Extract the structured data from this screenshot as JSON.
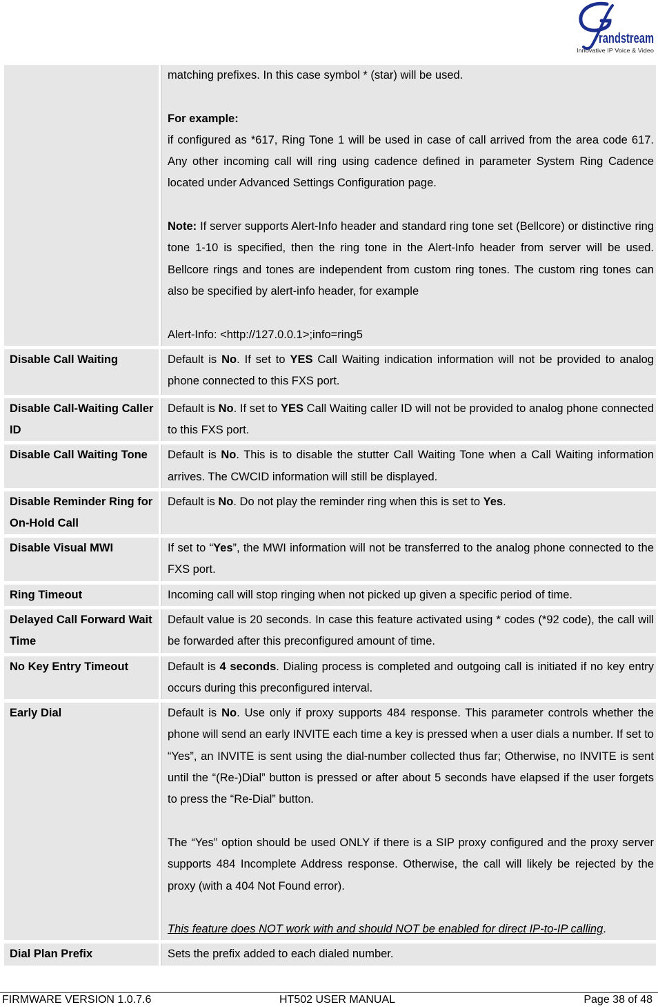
{
  "header": {
    "logo_text": "randstream",
    "logo_initial": "G",
    "logo_tagline": "Innovative IP Voice & Video",
    "logo_color": "#1b2f8f"
  },
  "table": {
    "rows": [
      {
        "name": "",
        "desc": {
          "line1": "matching prefixes. In this case symbol * (star) will be used.",
          "example_label": "For example:",
          "example_text": " if configured as *617, Ring Tone 1 will be used in case of call arrived from the area code 617. Any other incoming call will ring using cadence defined in parameter System Ring Cadence located under Advanced Settings Configuration page.",
          "note_label": "Note:",
          "note_text": " If server supports Alert-Info header and standard ring tone set (Bellcore) or distinctive ring tone 1-10 is specified, then the ring tone in the Alert-Info header from server will be used. Bellcore rings and tones are independent from custom ring tones. The custom ring tones can also be specified by alert-info header, for example",
          "alert_example": "Alert-Info: <http://127.0.0.1>;info=ring5"
        }
      },
      {
        "name": "Disable Call Waiting",
        "desc": {
          "a": "Default is ",
          "b": "No",
          "c": ". If set to ",
          "d": "YES",
          "e": " Call Waiting indication information will not be provided to analog phone connected to this FXS port."
        }
      },
      {
        "name": "Disable Call-Waiting Caller ID",
        "desc": {
          "a": "Default is ",
          "b": "No",
          "c": ". If set to ",
          "d": "YES",
          "e": " Call Waiting caller ID will not be provided to analog phone connected to this FXS port."
        }
      },
      {
        "name": "Disable Call Waiting Tone",
        "desc": {
          "a": "Default is ",
          "b": "No",
          "c": ". This is to disable the stutter Call Waiting Tone when a Call Waiting information arrives. The CWCID information will still be displayed."
        }
      },
      {
        "name": "Disable Reminder Ring for On-Hold Call",
        "desc": {
          "a": "Default is ",
          "b": "No",
          "c": ". Do not play the reminder ring when this is set to ",
          "d": "Yes",
          "e": "."
        }
      },
      {
        "name": "Disable Visual MWI",
        "desc": {
          "a": "If set to “",
          "b": "Yes",
          "c": "”, the MWI information will not be transferred to the analog phone connected to the FXS port."
        }
      },
      {
        "name": "Ring Timeout",
        "desc": {
          "a": "Incoming call will stop ringing when not picked up given a specific period of time."
        }
      },
      {
        "name": "Delayed Call Forward Wait Time",
        "desc": {
          "a": "Default value is 20 seconds. In case this feature activated using * codes (*92 code), the call will be forwarded after this preconfigured amount of time."
        }
      },
      {
        "name": "No Key Entry Timeout",
        "desc": {
          "a": "Default is ",
          "b": "4 seconds",
          "c": ". Dialing process is completed and outgoing call is initiated if no key entry occurs during this preconfigured interval."
        }
      },
      {
        "name": "Early Dial",
        "desc": {
          "a": "Default is ",
          "b": "No",
          "c": ". Use only if proxy supports 484 response.  This parameter controls whether the phone will send an early INVITE each time a key is pressed when a user dials a number.  If set to “Yes”, an INVITE is sent using the dial-number collected thus far;  Otherwise, no INVITE is sent until the “(Re-)Dial” button is pressed or after about 5 seconds have elapsed if the user forgets to press the “Re-Dial” button.",
          "p2": "The “Yes” option should be used ONLY if there is a SIP proxy configured and the proxy server supports 484 Incomplete Address response. Otherwise, the call will likely be rejected by the proxy (with a 404 Not Found error).",
          "p3": "This feature does NOT work with and should NOT be enabled for direct IP-to-IP calling",
          "p3_end": "."
        }
      },
      {
        "name": "Dial Plan Prefix",
        "desc": {
          "a": "Sets the prefix added to each dialed number."
        }
      }
    ]
  },
  "footer": {
    "firmware": "FIRMWARE VERSION 1.0.7.6",
    "manual": "HT502 USER MANUAL",
    "page": "Page 38 of 48"
  }
}
